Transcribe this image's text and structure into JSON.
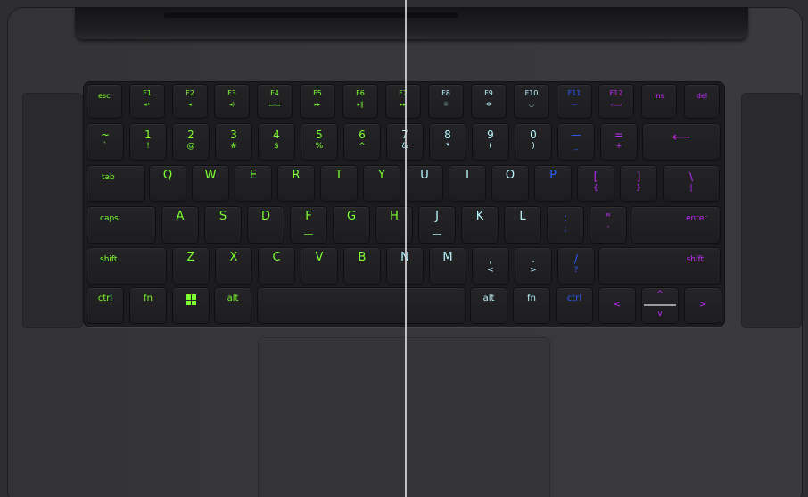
{
  "colors": {
    "left_glow": "#7cff2e",
    "mid_glow": "#b8f7ff",
    "right_glow_blue": "#2e5bff",
    "right_glow_purple": "#c12cff"
  },
  "keyboard": {
    "row0": [
      {
        "label": "esc",
        "sub": ""
      },
      {
        "label": "F1",
        "sub": "◂•"
      },
      {
        "label": "F2",
        "sub": "◂"
      },
      {
        "label": "F3",
        "sub": "◂)"
      },
      {
        "label": "F4",
        "sub": "▭▭"
      },
      {
        "label": "F5",
        "sub": "▸▸"
      },
      {
        "label": "F6",
        "sub": "▸‖"
      },
      {
        "label": "F7",
        "sub": "▸▸"
      },
      {
        "label": "F8",
        "sub": "☼"
      },
      {
        "label": "F9",
        "sub": "✲"
      },
      {
        "label": "F10",
        "sub": "◡"
      },
      {
        "label": "F11",
        "sub": "—"
      },
      {
        "label": "F12",
        "sub": "▭▭"
      },
      {
        "label": "ins",
        "sub": ""
      },
      {
        "label": "del",
        "sub": ""
      }
    ],
    "row1": [
      {
        "top": "~",
        "bot": "`"
      },
      {
        "top": "1",
        "bot": "!"
      },
      {
        "top": "2",
        "bot": "@"
      },
      {
        "top": "3",
        "bot": "#"
      },
      {
        "top": "4",
        "bot": "$"
      },
      {
        "top": "5",
        "bot": "%"
      },
      {
        "top": "6",
        "bot": "^"
      },
      {
        "top": "7",
        "bot": "&"
      },
      {
        "top": "8",
        "bot": "*"
      },
      {
        "top": "9",
        "bot": "("
      },
      {
        "top": "0",
        "bot": ")"
      },
      {
        "top": "—",
        "bot": "_"
      },
      {
        "top": "=",
        "bot": "+"
      },
      {
        "top": "⟵",
        "bot": ""
      }
    ],
    "row2": [
      {
        "label": "tab"
      },
      {
        "label": "Q"
      },
      {
        "label": "W"
      },
      {
        "label": "E"
      },
      {
        "label": "R"
      },
      {
        "label": "T"
      },
      {
        "label": "Y"
      },
      {
        "label": "U"
      },
      {
        "label": "I"
      },
      {
        "label": "O"
      },
      {
        "label": "P"
      },
      {
        "label": "[",
        "sub": "{"
      },
      {
        "label": "]",
        "sub": "}"
      },
      {
        "label": "\\",
        "sub": "|"
      }
    ],
    "row3": [
      {
        "label": "caps"
      },
      {
        "label": "A"
      },
      {
        "label": "S"
      },
      {
        "label": "D"
      },
      {
        "label": "F"
      },
      {
        "label": "G"
      },
      {
        "label": "H"
      },
      {
        "label": "J"
      },
      {
        "label": "K"
      },
      {
        "label": "L"
      },
      {
        "label": ":",
        "sub": ";"
      },
      {
        "label": "\"",
        "sub": "'"
      },
      {
        "label": "enter"
      }
    ],
    "row4": [
      {
        "label": "shift"
      },
      {
        "label": "Z"
      },
      {
        "label": "X"
      },
      {
        "label": "C"
      },
      {
        "label": "V"
      },
      {
        "label": "B"
      },
      {
        "label": "N"
      },
      {
        "label": "M"
      },
      {
        "label": ",",
        "sub": "<"
      },
      {
        "label": ".",
        "sub": ">"
      },
      {
        "label": "/",
        "sub": "?"
      },
      {
        "label": "shift"
      }
    ],
    "row5": [
      {
        "label": "ctrl"
      },
      {
        "label": "fn"
      },
      {
        "label": "win"
      },
      {
        "label": "alt"
      },
      {
        "label": ""
      },
      {
        "label": "alt"
      },
      {
        "label": "fn"
      },
      {
        "label": "ctrl"
      },
      {
        "label": "<"
      },
      {
        "label": "^",
        "sub": "v"
      },
      {
        "label": ">"
      }
    ]
  }
}
